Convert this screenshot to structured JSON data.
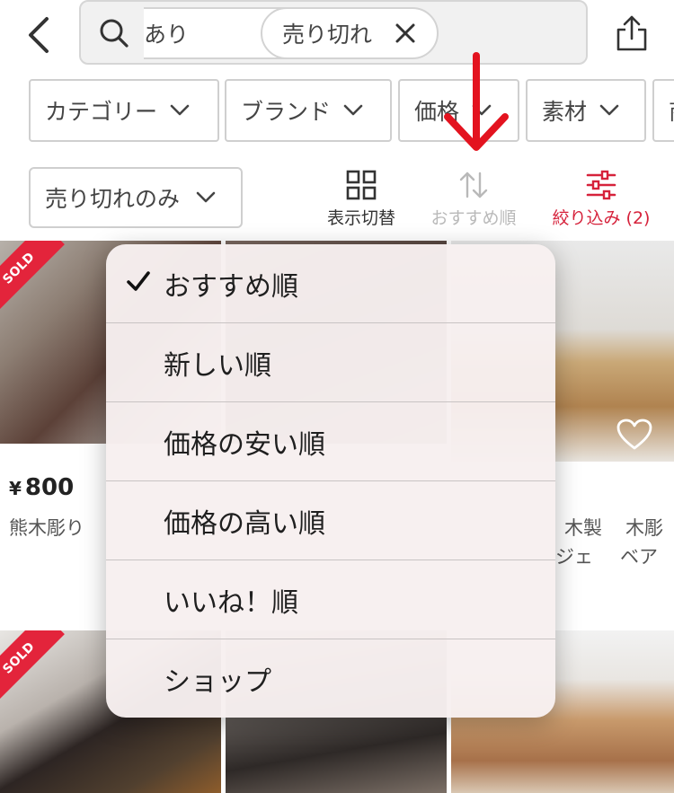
{
  "search": {
    "chips": [
      {
        "label": "あり"
      },
      {
        "label": "売り切れ"
      }
    ]
  },
  "filters": {
    "category": "カテゴリー",
    "brand": "ブランド",
    "price": "価格",
    "material": "素材",
    "more": "商"
  },
  "toolbar": {
    "sold_only": "売り切れのみ",
    "view_toggle": "表示切替",
    "sort": "おすすめ順",
    "filter": "絞り込み (2)"
  },
  "products": [
    {
      "sold_label": "SOLD",
      "price_symbol": "¥",
      "price": "800",
      "name": "熊木彫り"
    },
    {
      "name_parts": [
        "木製",
        "木彫",
        "ジェ",
        "ベア"
      ]
    },
    {
      "sold_label": "SOLD"
    }
  ],
  "sort_menu": {
    "selected_index": 0,
    "options": [
      {
        "label": "おすすめ順"
      },
      {
        "label": "新しい順"
      },
      {
        "label": "価格の安い順"
      },
      {
        "label": "価格の高い順"
      },
      {
        "label": "いいね！順"
      },
      {
        "label": "ショップ"
      }
    ]
  },
  "colors": {
    "accent_red": "#e3243b",
    "filter_red": "#d6223b",
    "disabled_gray": "#b9b9b9"
  }
}
